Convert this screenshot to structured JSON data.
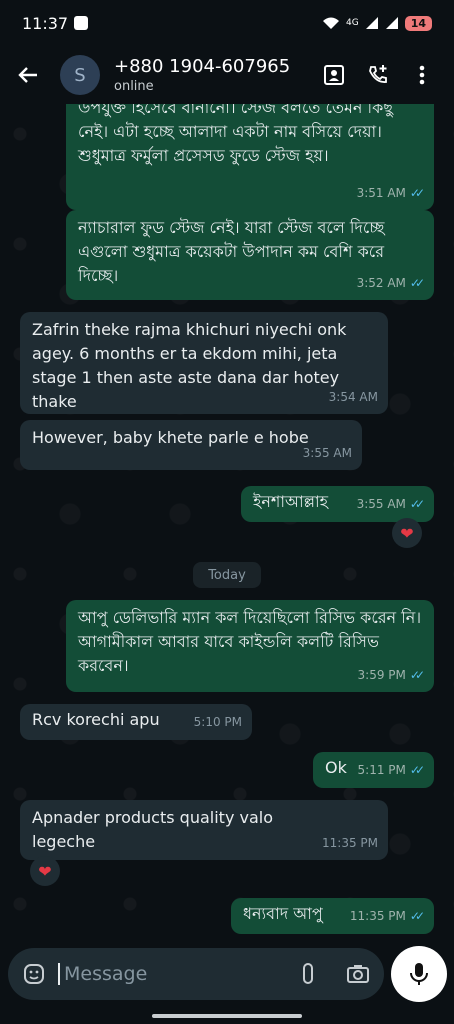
{
  "status": {
    "time": "11:37",
    "network": "4G",
    "battery": "14"
  },
  "header": {
    "avatar_letter": "S",
    "contact_name": "+880 1904-607965",
    "presence": "online"
  },
  "chat": {
    "messages": [
      {
        "text": "উপযুক্ত হিসেবে বানানো। স্টেজ বলতে তেমন কিছু নেই। এটা হচ্ছে আলাদা একটা নাম বসিয়ে দেয়া। শুধুমাত্র ফর্মুলা প্রসেসড ফুডে স্টেজ হয়।",
        "time": "3:51 AM"
      },
      {
        "text": "ন্যাচারাল ফুড স্টেজ নেই। যারা স্টেজ বলে দিচ্ছে এগুলো শুধুমাত্র কয়েকটা উপাদান কম বেশি করে দিচ্ছে।",
        "time": "3:52 AM"
      },
      {
        "text": "Zafrin theke rajma khichuri niyechi onk agey. 6 months er ta ekdom mihi, jeta stage 1 then aste aste dana dar hotey thake",
        "time": "3:54 AM"
      },
      {
        "text": "However,  baby khete parle e hobe",
        "time": "3:55 AM"
      },
      {
        "text": "ইনশাআল্লাহ",
        "time": "3:55 AM"
      },
      {
        "text": "আপু ডেলিভারি ম্যান কল দিয়েছিলো রিসিভ করেন নি। আগামীকাল আবার যাবে কাইন্ডলি কলটি রিসিভ করবেন।",
        "time": "3:59 PM"
      },
      {
        "text": "Rcv korechi apu",
        "time": "5:10 PM"
      },
      {
        "text": "Ok",
        "time": "5:11 PM"
      },
      {
        "text": "Apnader products quality  valo legeche",
        "time": "11:35 PM"
      },
      {
        "text": "ধন্যবাদ আপু",
        "time": "11:35 PM"
      }
    ],
    "day_divider": "Today",
    "reaction": "❤"
  },
  "composer": {
    "placeholder": "Message"
  },
  "colors": {
    "outgoing_bubble": "#134d37",
    "incoming_bubble": "#1f2c33",
    "read_ticks": "#53bdeb",
    "background": "#0b1014"
  }
}
